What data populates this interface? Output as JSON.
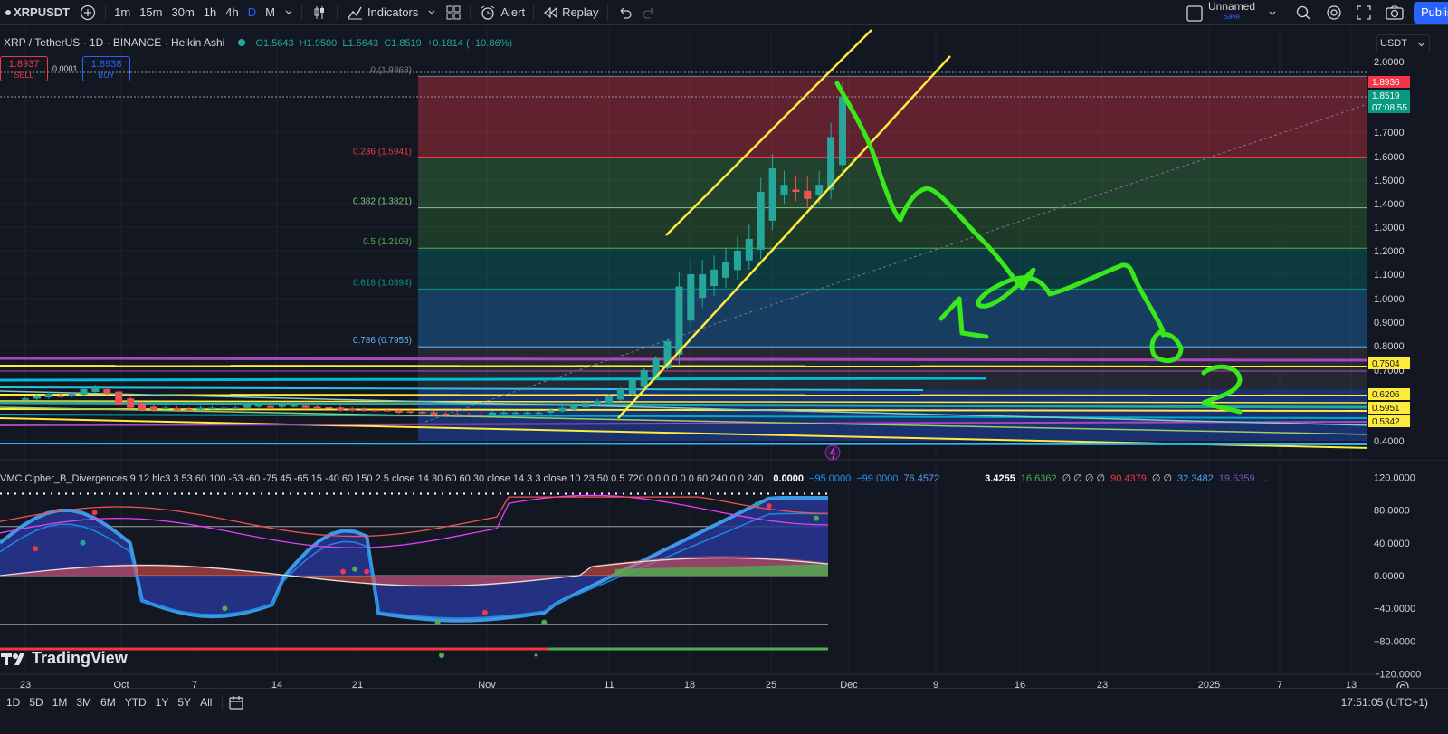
{
  "toolbar": {
    "symbol": "XRPUSDT",
    "intervals": [
      "1m",
      "15m",
      "30m",
      "1h",
      "4h",
      "D",
      "M"
    ],
    "active_interval": "D",
    "indicators_label": "Indicators",
    "alert_label": "Alert",
    "replay_label": "Replay",
    "layout_name": "Unnamed",
    "save_label": "Save",
    "publish_label": "Publish"
  },
  "legend": {
    "title": "XRP / TetherUS · 1D · BINANCE · Heikin Ashi",
    "o": "O1.5643",
    "h": "H1.9500",
    "l": "L1.5643",
    "c": "C1.8519",
    "change": "+0.1814 (+10.86%)"
  },
  "trade": {
    "sell_price": "1.8937",
    "sell_label": "SELL",
    "spread": "0.0001",
    "buy_price": "1.8938",
    "buy_label": "BUY"
  },
  "currency": "USDT",
  "fib": [
    {
      "label": "0 (1.9368)",
      "price": 1.9368,
      "color": "#787b86"
    },
    {
      "label": "0.236 (1.5941)",
      "price": 1.5941,
      "color": "#f23645"
    },
    {
      "label": "0.382 (1.3821)",
      "price": 1.3821,
      "color": "#81c784"
    },
    {
      "label": "0.5 (1.2108)",
      "price": 1.2108,
      "color": "#4caf50"
    },
    {
      "label": "0.618 (1.0394)",
      "price": 1.0394,
      "color": "#089981"
    },
    {
      "label": "0.786 (0.7955)",
      "price": 0.7955,
      "color": "#64b5f6"
    }
  ],
  "price_axis": [
    "2.0000",
    "1.7000",
    "1.6000",
    "1.5000",
    "1.4000",
    "1.3000",
    "1.2000",
    "1.1000",
    "1.0000",
    "0.9000",
    "0.8000",
    "0.7000",
    "0.4000"
  ],
  "price_tags": [
    {
      "text": "1.8936",
      "bg": "#f23645",
      "fg": "#ffffff",
      "price": 1.8936
    },
    {
      "text": "1.8519",
      "bg": "#089981",
      "fg": "#ffffff",
      "price": 1.8519
    },
    {
      "text": "07:08:55",
      "bg": "#089981",
      "fg": "#ffffff",
      "price": 1.8519
    },
    {
      "text": "0.7504",
      "bg": "#ffeb3b",
      "fg": "#131722",
      "price": 0.7504
    },
    {
      "text": "0.6206",
      "bg": "#ffeb3b",
      "fg": "#131722",
      "price": 0.6206
    },
    {
      "text": "0.5951",
      "bg": "#ffeb3b",
      "fg": "#131722",
      "price": 0.5951
    },
    {
      "text": "0.5342",
      "bg": "#ffeb3b",
      "fg": "#131722",
      "price": 0.5342
    }
  ],
  "indicator": {
    "name": "VMC Cipher_B_Divergences 9 12 hlc3 3 53 60 100 -53 -60 -75 45 -65 15 -40 60 150 2.5 close 14 30 60 60 30 close 14 3 3 close 10 23 50 0.5 720 0 0 0 0 0 0 60 240 0 0 240",
    "values": [
      {
        "text": "0.0000",
        "color": "#ffffff"
      },
      {
        "text": "−95.0000",
        "color": "#2196f3"
      },
      {
        "text": "−99.0000",
        "color": "#2196f3"
      },
      {
        "text": "76.4572",
        "color": "#5b9cf6"
      },
      {
        "text": "3.4255",
        "color": "#ffffff"
      },
      {
        "text": "16.6362",
        "color": "#4caf50"
      },
      {
        "text": "∅ ∅ ∅ ∅",
        "color": "#d1d4dc"
      },
      {
        "text": "90.4379",
        "color": "#f23645"
      },
      {
        "text": "∅ ∅",
        "color": "#d1d4dc"
      },
      {
        "text": "32.3482",
        "color": "#42a5f5"
      },
      {
        "text": "19.6359",
        "color": "#7e57c2"
      },
      {
        "text": "...",
        "color": "#d1d4dc"
      }
    ],
    "axis": [
      "120.0000",
      "80.0000",
      "40.0000",
      "0.0000",
      "−40.0000",
      "−80.0000",
      "−120.0000"
    ]
  },
  "time_axis": [
    "23",
    "Oct",
    "7",
    "14",
    "21",
    "Nov",
    "11",
    "18",
    "25",
    "Dec",
    "9",
    "16",
    "23",
    "2025",
    "7",
    "13"
  ],
  "ranges": [
    "1D",
    "5D",
    "1M",
    "3M",
    "6M",
    "YTD",
    "1Y",
    "5Y",
    "All"
  ],
  "clock": "17:51:05 (UTC+1)",
  "watermark": "TradingView",
  "annotations": {
    "one": "1",
    "two": "2"
  },
  "colors": {
    "bg": "#131722",
    "up": "#26a69a",
    "down": "#ef5350",
    "drawing": "#39e81a",
    "channel": "#ffeb3b"
  },
  "chart_data": {
    "type": "candlestick",
    "symbol": "XRP / TetherUS",
    "ohlc_last": {
      "open": 1.5643,
      "high": 1.95,
      "low": 1.5643,
      "close": 1.8519
    },
    "closes_sep23_to_nov29": [
      0.58,
      0.59,
      0.6,
      0.59,
      0.6,
      0.62,
      0.63,
      0.6,
      0.55,
      0.54,
      0.53,
      0.53,
      0.54,
      0.53,
      0.53,
      0.54,
      0.54,
      0.54,
      0.54,
      0.55,
      0.55,
      0.54,
      0.55,
      0.55,
      0.54,
      0.54,
      0.54,
      0.53,
      0.53,
      0.53,
      0.53,
      0.53,
      0.52,
      0.52,
      0.52,
      0.51,
      0.51,
      0.51,
      0.51,
      0.51,
      0.52,
      0.52,
      0.52,
      0.52,
      0.52,
      0.53,
      0.54,
      0.55,
      0.56,
      0.57,
      0.59,
      0.62,
      0.66,
      0.7,
      0.75,
      0.82,
      1.05,
      1.1,
      1.1,
      1.12,
      1.15,
      1.2,
      1.25,
      1.45,
      1.55,
      1.48,
      1.45,
      1.42,
      1.48,
      1.68,
      1.85
    ]
  }
}
